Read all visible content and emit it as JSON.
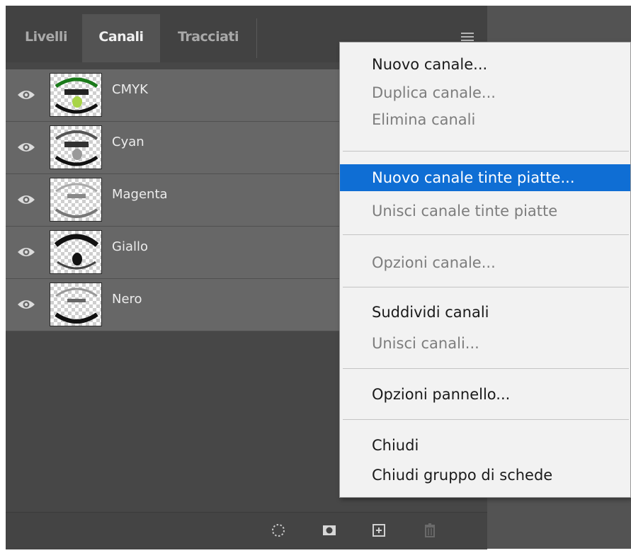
{
  "tabs": [
    {
      "label": "Livelli",
      "active": false
    },
    {
      "label": "Canali",
      "active": true
    },
    {
      "label": "Tracciati",
      "active": false
    }
  ],
  "channels": [
    {
      "name": "CMYK",
      "visible": true
    },
    {
      "name": "Cyan",
      "visible": true
    },
    {
      "name": "Magenta",
      "visible": true
    },
    {
      "name": "Giallo",
      "visible": true
    },
    {
      "name": "Nero",
      "visible": true
    }
  ],
  "menu": {
    "items": [
      {
        "label": "Nuovo canale...",
        "state": "enabled"
      },
      {
        "label": "Duplica canale...",
        "state": "disabled"
      },
      {
        "label": "Elimina canali",
        "state": "disabled"
      },
      {
        "label": "Nuovo canale tinte piatte...",
        "state": "highlighted"
      },
      {
        "label": "Unisci canale tinte piatte",
        "state": "disabled"
      },
      {
        "label": "Opzioni canale...",
        "state": "disabled"
      },
      {
        "label": "Suddividi canali",
        "state": "enabled"
      },
      {
        "label": "Unisci canali...",
        "state": "disabled"
      },
      {
        "label": "Opzioni pannello...",
        "state": "enabled"
      },
      {
        "label": "Chiudi",
        "state": "enabled"
      },
      {
        "label": "Chiudi gruppo di schede",
        "state": "enabled"
      }
    ]
  },
  "footer_icons": [
    "load-selection-icon",
    "save-selection-icon",
    "new-channel-icon",
    "trash-icon"
  ],
  "colors": {
    "highlight": "#0f6ed4",
    "panel": "#474747",
    "row": "#676767",
    "menu_bg": "#f2f2f2"
  }
}
